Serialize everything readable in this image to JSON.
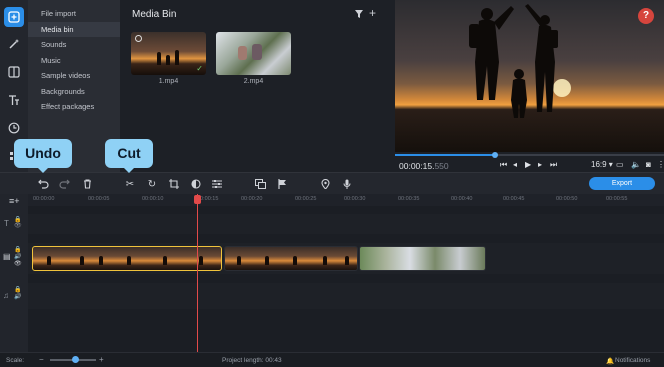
{
  "menu": {
    "items": [
      {
        "label": "File import"
      },
      {
        "label": "Media bin",
        "active": true
      },
      {
        "label": "Sounds"
      },
      {
        "label": "Music"
      },
      {
        "label": "Sample videos"
      },
      {
        "label": "Backgrounds"
      },
      {
        "label": "Effect packages"
      }
    ]
  },
  "rail": {
    "icons": [
      "import-icon",
      "magic-wand-icon",
      "filters-icon",
      "text-icon",
      "clock-icon",
      "more-icon"
    ]
  },
  "media_bin": {
    "title": "Media Bin",
    "files": [
      {
        "name": "1.mp4",
        "selected": true
      },
      {
        "name": "2.mp4"
      }
    ]
  },
  "preview": {
    "time_main": "00:00:15.",
    "time_frac": "550",
    "progress": 0.37,
    "aspect_ratio": "16:9",
    "help": "?"
  },
  "toolbar": {
    "export_label": "Export",
    "icons": [
      "undo-icon",
      "redo-icon",
      "delete-icon",
      "cut-icon",
      "rotate-icon",
      "crop-icon",
      "color-icon",
      "adjust-icon",
      "overlay-icon",
      "flag-icon",
      "location-icon",
      "microphone-icon"
    ]
  },
  "tooltips": {
    "undo": "Undo",
    "cut": "Cut"
  },
  "ruler": {
    "ticks": [
      "00:00:00",
      "00:00:05",
      "00:00:10",
      "00:00:15",
      "00:00:20",
      "00:00:25",
      "00:00:30",
      "00:00:35",
      "00:00:40",
      "00:00:45",
      "00:00:50",
      "00:00:55"
    ]
  },
  "status": {
    "scale_label": "Scale:",
    "project_length": "Project length:  00:43",
    "notifications": "Notifications",
    "scale_level": 0.55
  },
  "colors": {
    "accent": "#2b8ee8",
    "tooltip": "#8fd1f5",
    "playhead": "#e24a4a",
    "selection": "#f0c33c"
  }
}
